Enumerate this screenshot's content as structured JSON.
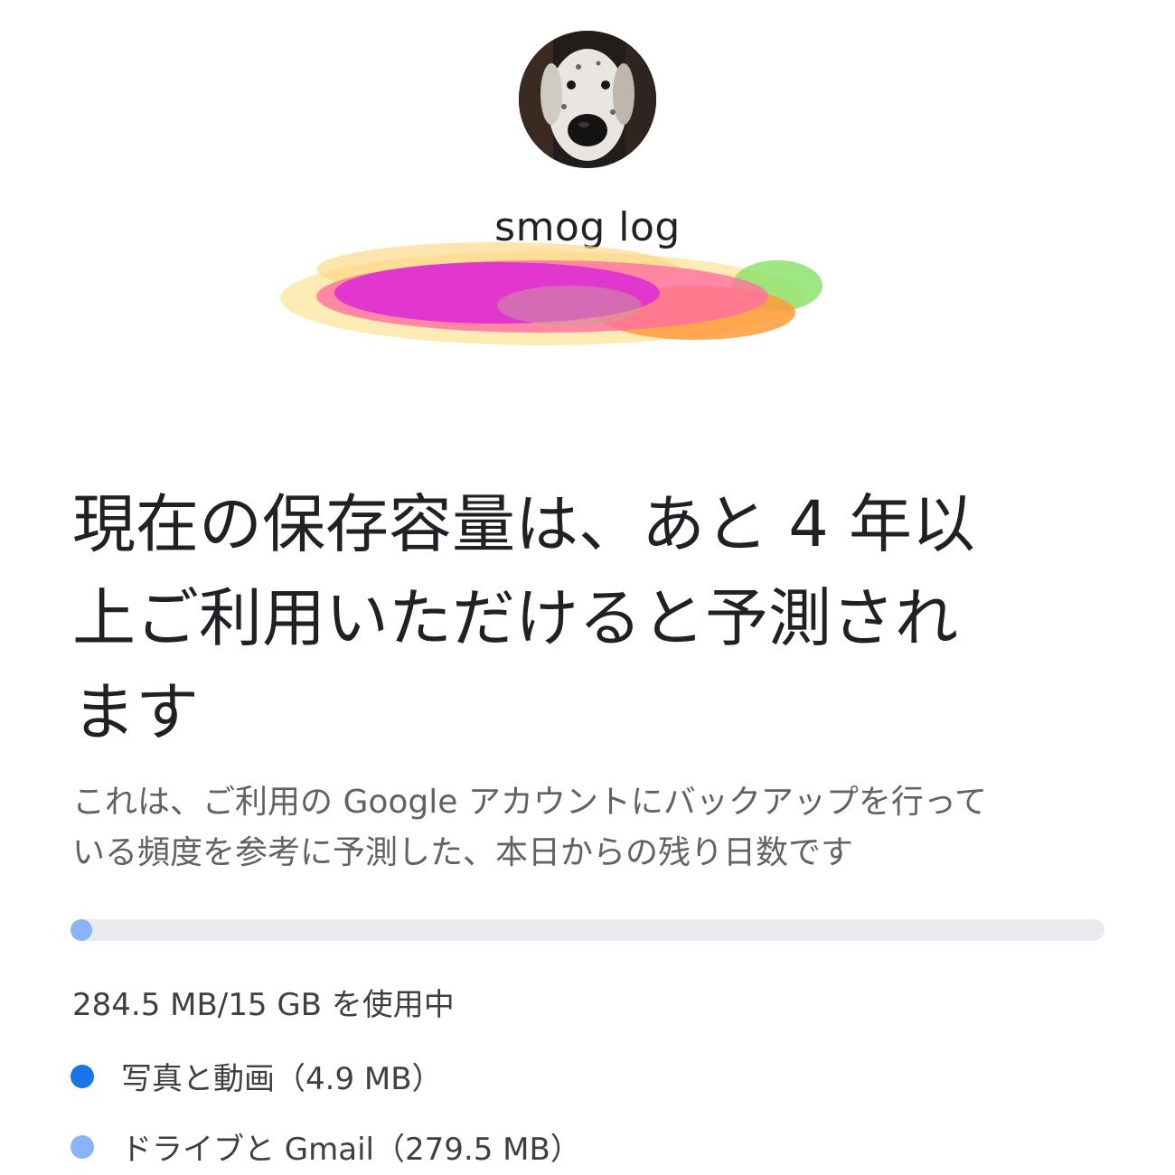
{
  "account": {
    "name": "smog log",
    "avatar_icon": "dalmatian-avatar"
  },
  "headline": {
    "lines": [
      "現在の保存容量は、あと 4 年以",
      "上ご利用いただけると予測され",
      "ます"
    ]
  },
  "description": {
    "lines": [
      "これは、ご利用の Google アカウントにバックアップを行って",
      "いる頻度を参考に予測した、本日からの残り日数です"
    ]
  },
  "storage": {
    "usage_text": "284.5 MB/15 GB を使用中",
    "used_fraction": 0.0185,
    "bar_track_color": "#e8eaed",
    "bar_fill_color": "#8ab4f8",
    "legend": [
      {
        "label": "写真と動画（4.9 MB）",
        "color": "#1a73e8"
      },
      {
        "label": "ドライブと Gmail（279.5 MB）",
        "color": "#8ab4f8"
      }
    ]
  }
}
